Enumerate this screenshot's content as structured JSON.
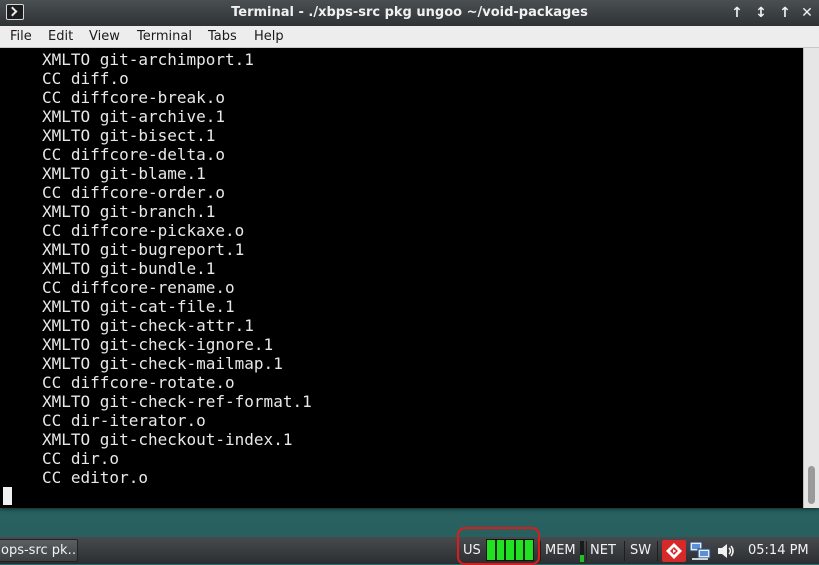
{
  "window": {
    "title": "Terminal - ./xbps-src pkg ungoo ~/void-packages",
    "buttons": {
      "minimize": "↕",
      "shade": "↑",
      "maximize": "↑",
      "close": "✕"
    }
  },
  "menubar": {
    "items": [
      "File",
      "Edit",
      "View",
      "Terminal",
      "Tabs",
      "Help"
    ]
  },
  "terminal": {
    "lines": [
      "XMLTO git-archimport.1",
      "CC diff.o",
      "CC diffcore-break.o",
      "XMLTO git-archive.1",
      "XMLTO git-bisect.1",
      "CC diffcore-delta.o",
      "XMLTO git-blame.1",
      "CC diffcore-order.o",
      "XMLTO git-branch.1",
      "CC diffcore-pickaxe.o",
      "XMLTO git-bugreport.1",
      "XMLTO git-bundle.1",
      "CC diffcore-rename.o",
      "XMLTO git-cat-file.1",
      "XMLTO git-check-attr.1",
      "XMLTO git-check-ignore.1",
      "XMLTO git-check-mailmap.1",
      "CC diffcore-rotate.o",
      "XMLTO git-check-ref-format.1",
      "CC dir-iterator.o",
      "XMLTO git-checkout-index.1",
      "CC dir.o",
      "CC editor.o"
    ]
  },
  "taskbar": {
    "task_label": "ops-src pk…",
    "keyboard_layout": "US",
    "mem_label": "MEM",
    "net_label": "NET",
    "sw_label": "SW",
    "clock": "05:14 PM",
    "cpu_levels": [
      1.0,
      1.0,
      1.0,
      1.0,
      1.0
    ],
    "mem_level": 0.35,
    "icons": [
      "update-icon",
      "network-icon",
      "volume-icon"
    ]
  },
  "colors": {
    "highlight": "#e01a1a",
    "graph_green": "#22e022",
    "terminal_bg": "#000000",
    "terminal_fg": "#e8e8e8"
  }
}
